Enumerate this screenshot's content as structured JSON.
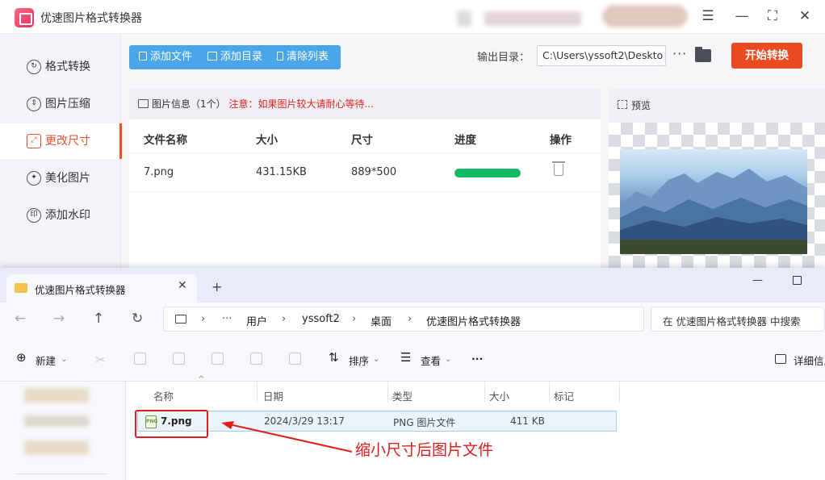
{
  "app": {
    "title": "优速图片格式转换器",
    "sidebar": [
      {
        "label": "格式转换",
        "icon": "format-convert-icon",
        "glyph": "↻"
      },
      {
        "label": "图片压缩",
        "icon": "compress-icon",
        "glyph": "⇕"
      },
      {
        "label": "更改尺寸",
        "icon": "resize-icon",
        "glyph": "⤢",
        "active": true
      },
      {
        "label": "美化图片",
        "icon": "beautify-icon",
        "glyph": "✦"
      },
      {
        "label": "添加水印",
        "icon": "watermark-icon",
        "glyph": "印"
      }
    ],
    "toolbar": {
      "add_file": "添加文件",
      "add_dir": "添加目录",
      "clear_list": "清除列表"
    },
    "output": {
      "label": "输出目录：",
      "path": "C:\\Users\\yssoft2\\Deskto",
      "more": "···"
    },
    "start_button": "开始转换",
    "panel": {
      "title": "图片信息（1个）",
      "warning": "注意：如果图片较大请耐心等待...",
      "columns": [
        "文件名称",
        "大小",
        "尺寸",
        "进度",
        "操作"
      ],
      "rows": [
        {
          "name": "7.png",
          "size": "431.15KB",
          "dims": "889*500",
          "progress": 1.0
        }
      ]
    },
    "preview": {
      "title": "预览"
    },
    "colors": {
      "accent": "#ea4a1f",
      "toolbar": "#4aa6e8",
      "progress": "#17b864",
      "warning": "#e02020"
    }
  },
  "explorer": {
    "tab_title": "优速图片格式转换器",
    "breadcrumbs": [
      "用户",
      "yssoft2",
      "桌面",
      "优速图片格式转换器"
    ],
    "search_placeholder": "在 优速图片格式转换器 中搜索",
    "commands": {
      "new": "新建",
      "sort": "排序",
      "view": "查看",
      "more": "···",
      "details": "详细信息"
    },
    "columns": [
      "名称",
      "日期",
      "类型",
      "大小",
      "标记"
    ],
    "files": [
      {
        "name": "7.png",
        "date": "2024/3/29 13:17",
        "type": "PNG 图片文件",
        "size": "411 KB"
      }
    ],
    "annotation": "缩小尺寸后图片文件"
  }
}
